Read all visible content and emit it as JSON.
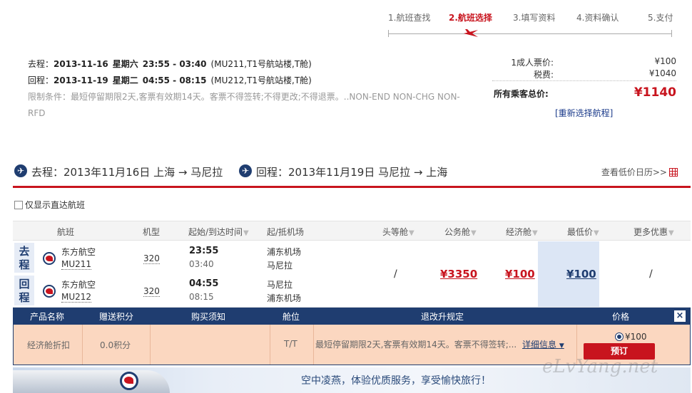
{
  "steps": [
    {
      "label": "1.航班查找",
      "active": false
    },
    {
      "label": "2.航班选择",
      "active": true
    },
    {
      "label": "3.填写资料",
      "active": false
    },
    {
      "label": "4.资料确认",
      "active": false
    },
    {
      "label": "5.支付",
      "active": false
    }
  ],
  "summary": {
    "outbound": {
      "prefix": "去程：",
      "date": "2013-11-16",
      "weekday": "星期六",
      "time": "23:55 - 03:40",
      "detail": "(MU211,T1号航站楼,T舱)"
    },
    "inbound": {
      "prefix": "回程：",
      "date": "2013-11-19",
      "weekday": "星期二",
      "time": "04:55 - 08:15",
      "detail": "(MU212,T1号航站楼,T舱)"
    },
    "restriction": "限制条件：最短停留期限2天,客票有效期14天。客票不得签转;不得更改;不得退票。..NON-END NON-CHG NON-RFD",
    "fare_label": "1成人票价:",
    "fare_value": "¥100",
    "tax_label": "税费:",
    "tax_value": "¥1040",
    "total_label": "所有乘客总价:",
    "total_value": "¥1140",
    "reselect": "[重新选择航程]"
  },
  "route": {
    "outbound": "去程：2013年11月16日 上海 → 马尼拉",
    "inbound": "回程：2013年11月19日 马尼拉 → 上海",
    "calendar_link": "查看低价日历>>"
  },
  "filter": {
    "direct_only": "仅显示直达航班"
  },
  "table": {
    "headers": {
      "flight": "航班",
      "aircraft": "机型",
      "time": "起始/到达时间",
      "airport": "起/抵机场",
      "first": "头等舱",
      "business": "公务舱",
      "economy": "经济舱",
      "lowest": "最低价",
      "more": "更多优惠"
    },
    "rows": [
      {
        "dir": "去程",
        "airline": "东方航空",
        "flight_no": "MU211",
        "aircraft": "320",
        "dep_time": "23:55",
        "arr_time": "03:40",
        "dep_airport": "浦东机场",
        "arr_airport": "马尼拉"
      },
      {
        "dir": "回程",
        "airline": "东方航空",
        "flight_no": "MU212",
        "aircraft": "320",
        "dep_time": "04:55",
        "arr_time": "08:15",
        "dep_airport": "马尼拉",
        "arr_airport": "浦东机场"
      }
    ],
    "prices": {
      "first": "/",
      "business": "¥3350",
      "economy": "¥100",
      "lowest": "¥100",
      "more": "/"
    }
  },
  "product": {
    "headers": {
      "name": "产品名称",
      "points": "赠送积分",
      "notice": "购买须知",
      "cabin": "舱位",
      "rules": "退改升规定",
      "price": "价格"
    },
    "close": "×",
    "name": "经济舱折扣",
    "points": "0.0积分",
    "cabin": "T/T",
    "rules": "最短停留期限2天,客票有效期14天。客票不得签转;...",
    "detail_link": "详细信息",
    "price": "¥100",
    "book": "预订"
  },
  "banner": {
    "text": "空中凌燕，体验优质服务，享受愉快旅行！"
  },
  "watermark": "eLvYang.net",
  "colors": {
    "brand_red": "#c8141e",
    "brand_navy": "#1f3d70",
    "product_row": "#fbd7c0"
  }
}
